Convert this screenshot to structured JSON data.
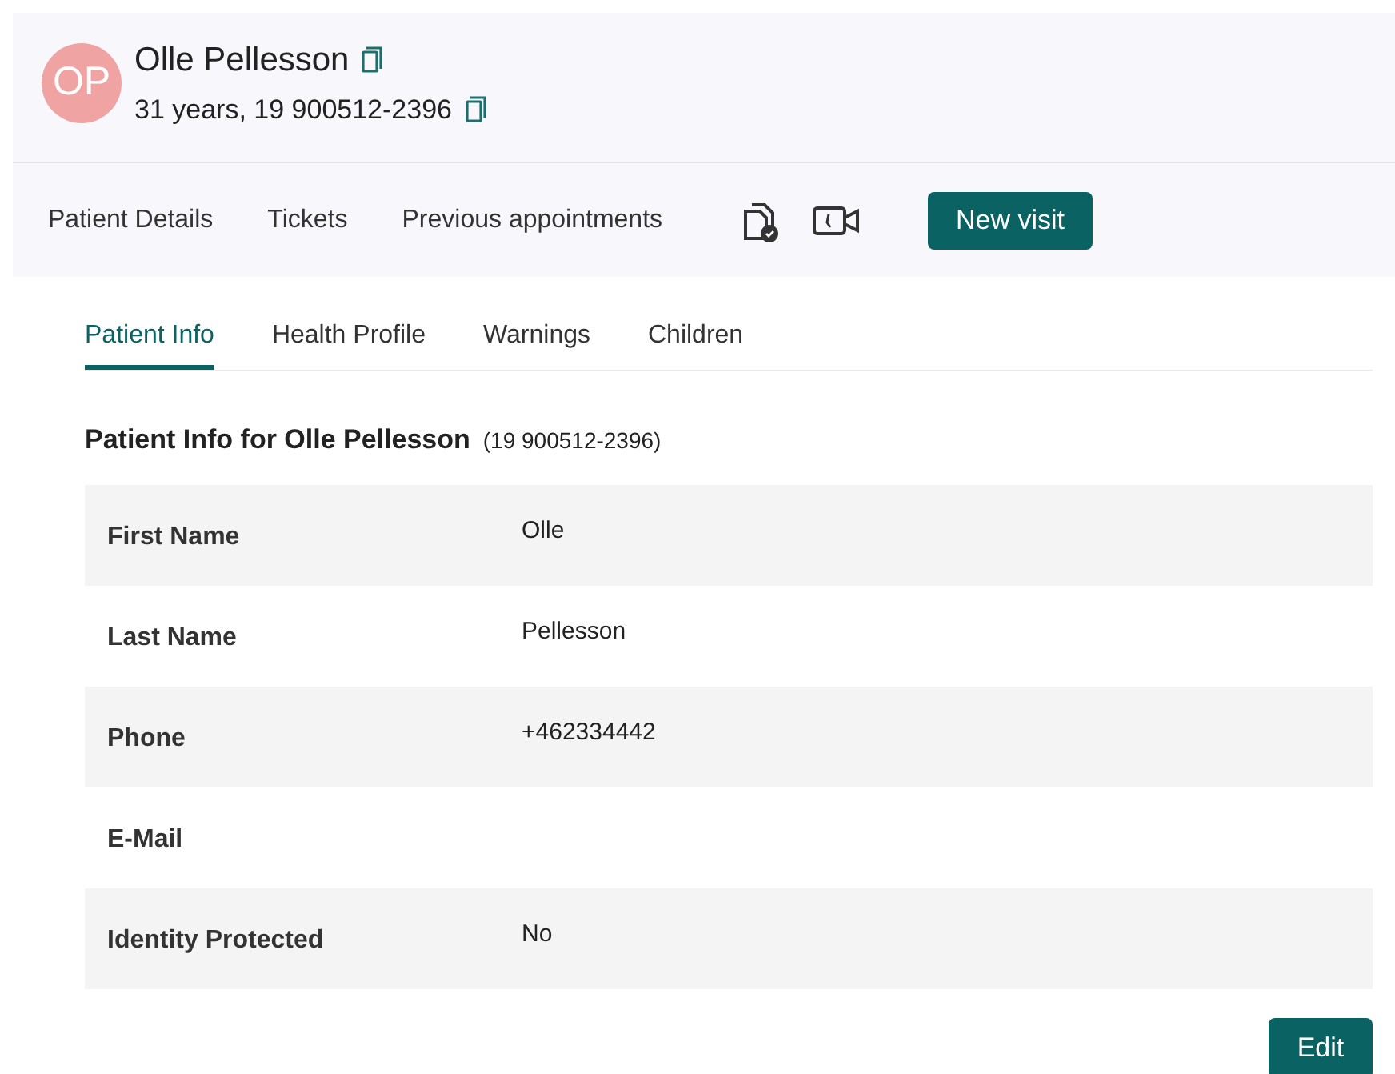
{
  "patient": {
    "initials": "OP",
    "name": "Olle Pellesson",
    "subtitle": "31 years, 19 900512-2396"
  },
  "nav": [
    {
      "label": "Patient Details"
    },
    {
      "label": "Tickets"
    },
    {
      "label": "Previous appointments"
    }
  ],
  "new_visit_button": "New visit",
  "tabs": [
    {
      "label": "Patient Info",
      "selected": true
    },
    {
      "label": "Health Profile",
      "selected": false
    },
    {
      "label": "Warnings",
      "selected": false
    },
    {
      "label": "Children",
      "selected": false
    }
  ],
  "heading": {
    "title": "Patient Info for Olle Pellesson",
    "id": "(19 900512-2396)"
  },
  "fields": [
    {
      "label": "First Name",
      "value": "Olle"
    },
    {
      "label": "Last Name",
      "value": "Pellesson"
    },
    {
      "label": "Phone",
      "value": "+462334442"
    },
    {
      "label": "E-Mail"
    },
    {
      "label": "Identity Protected",
      "value": "No"
    }
  ],
  "edit_button": "Edit"
}
